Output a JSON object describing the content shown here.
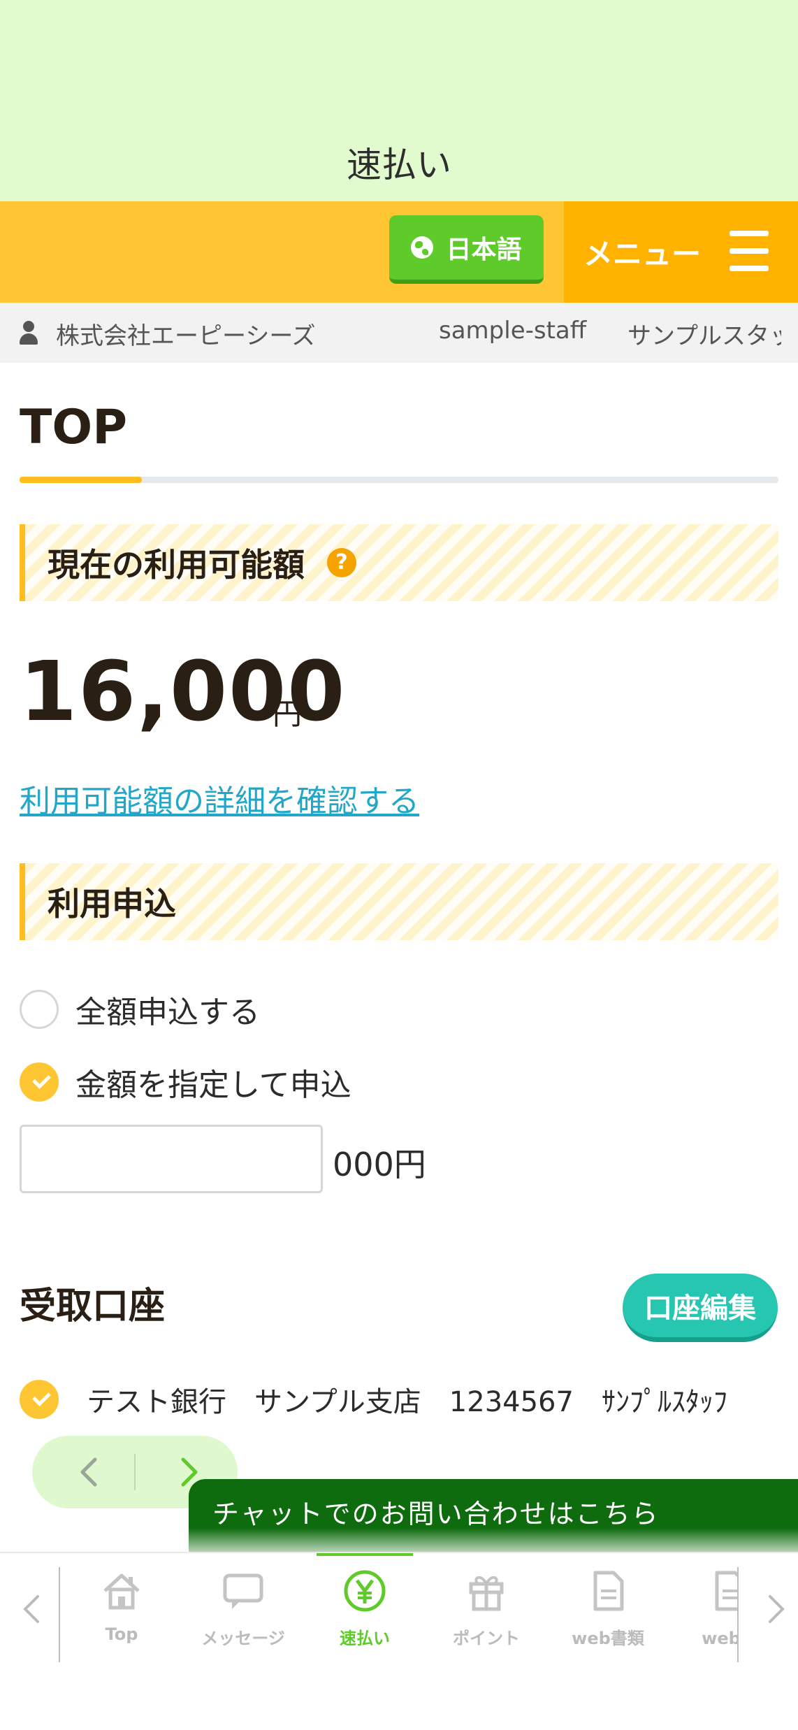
{
  "page_header": {
    "title": "速払い"
  },
  "topbar": {
    "language_label": "日本語",
    "menu_label": "メニュー"
  },
  "user_strip": {
    "company": "株式会社エーピーシーズ",
    "staff_id": "sample-staff",
    "staff_name": "サンプルスタッフ"
  },
  "page": {
    "title": "TOP"
  },
  "available": {
    "heading": "現在の利用可能額",
    "help_glyph": "?",
    "amount": "16,000",
    "unit": "円",
    "detail_link": "利用可能額の詳細を確認する"
  },
  "application": {
    "heading": "利用申込",
    "options": [
      {
        "label": "全額申込する",
        "selected": false
      },
      {
        "label": "金額を指定して申込",
        "selected": true
      }
    ],
    "amount_input_value": "",
    "amount_suffix": "000円"
  },
  "account": {
    "heading": "受取口座",
    "edit_button": "口座編集",
    "entry": "テスト銀行　サンプル支店　1234567　ｻﾝﾌﾟﾙｽﾀｯﾌ",
    "selected": true
  },
  "chat": {
    "label": "チャットでのお問い合わせはこちら"
  },
  "bottom_nav": {
    "items": [
      {
        "label": "Top",
        "icon": "home-icon",
        "active": false
      },
      {
        "label": "メッセージ",
        "icon": "message-icon",
        "active": false
      },
      {
        "label": "速払い",
        "icon": "yen-icon",
        "active": true
      },
      {
        "label": "ポイント",
        "icon": "gift-icon",
        "active": false
      },
      {
        "label": "web書類",
        "icon": "document-icon",
        "active": false
      },
      {
        "label": "web契",
        "icon": "document-icon",
        "active": false
      }
    ]
  },
  "colors": {
    "header_bg": "#e1fbcf",
    "topbar_bg": "#ffc633",
    "menu_bg": "#ffb300",
    "language_green": "#5ecb2b",
    "accent_teal": "#26c6b1",
    "link_blue": "#22a6c9",
    "chat_green": "#0e6b0e"
  }
}
